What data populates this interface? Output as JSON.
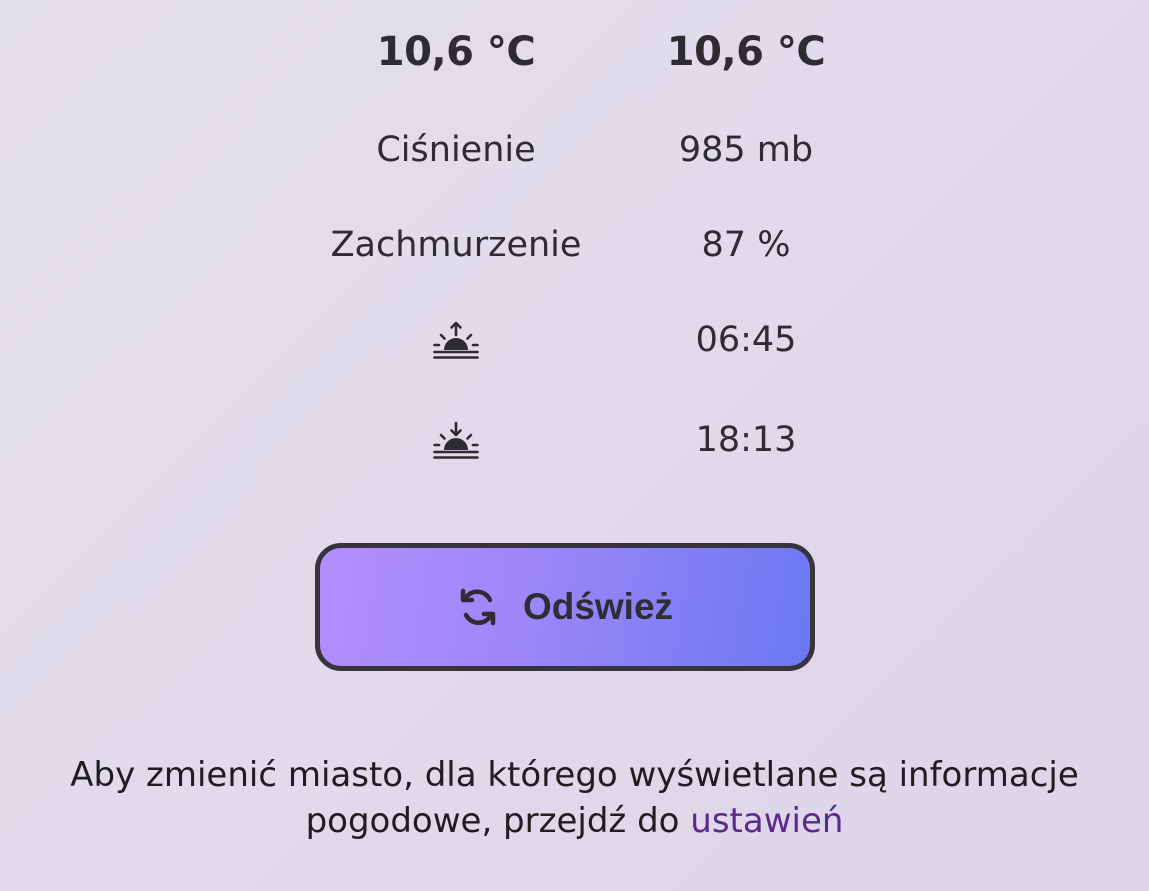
{
  "weather": {
    "temp_left": "10,6 °C",
    "temp_right": "10,6 °C",
    "pressure_label": "Ciśnienie",
    "pressure_value": "985 mb",
    "cloud_label": "Zachmurzenie",
    "cloud_value": "87 %",
    "sunrise_icon": "sunrise-icon",
    "sunrise_time": "06:45",
    "sunset_icon": "sunset-icon",
    "sunset_time": "18:13"
  },
  "refresh": {
    "icon": "refresh-icon",
    "label": "Odśwież"
  },
  "info": {
    "text": "Aby zmienić miasto, dla którego wyświetlane są informacje pogodowe, przejdź do",
    "link_text": "ustawień"
  },
  "colors": {
    "background": "#e0dbea",
    "button_gradient_start": "#b38fff",
    "button_gradient_end": "#6b78f3",
    "link": "#5b2a8c",
    "text": "#2e2b33"
  }
}
